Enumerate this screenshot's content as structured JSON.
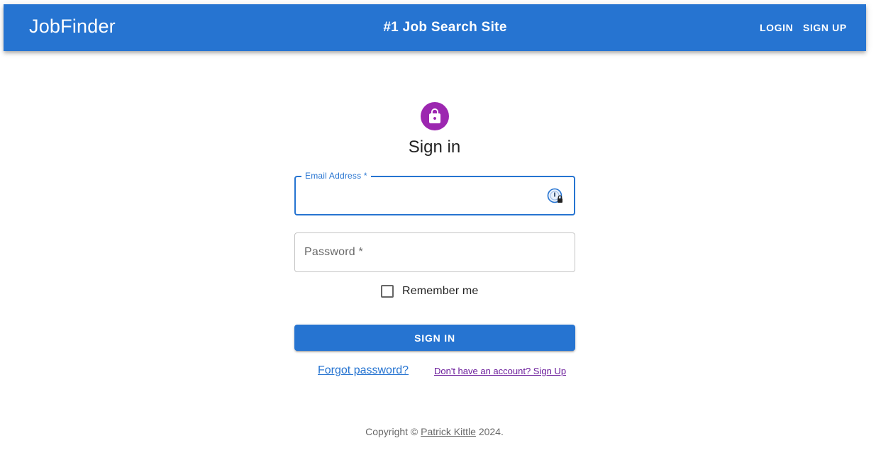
{
  "appbar": {
    "brand": "JobFinder",
    "tagline": "#1 Job Search Site",
    "login_label": "LOGIN",
    "signup_label": "SIGN UP",
    "color": "#2674d1"
  },
  "form": {
    "avatar_icon": "lock-icon",
    "avatar_color": "#9c27b0",
    "title": "Sign in",
    "email": {
      "label": "Email Address *",
      "value": "",
      "side_icon": "password-manager-icon"
    },
    "password": {
      "label": "Password *",
      "value": ""
    },
    "remember": {
      "label": "Remember me",
      "checked": false
    },
    "submit_label": "SIGN IN",
    "forgot_label": "Forgot password?",
    "signup_link_label": "Don't have an account? Sign Up"
  },
  "footer": {
    "prefix": "Copyright © ",
    "author": "Patrick Kittle",
    "suffix": " 2024."
  }
}
